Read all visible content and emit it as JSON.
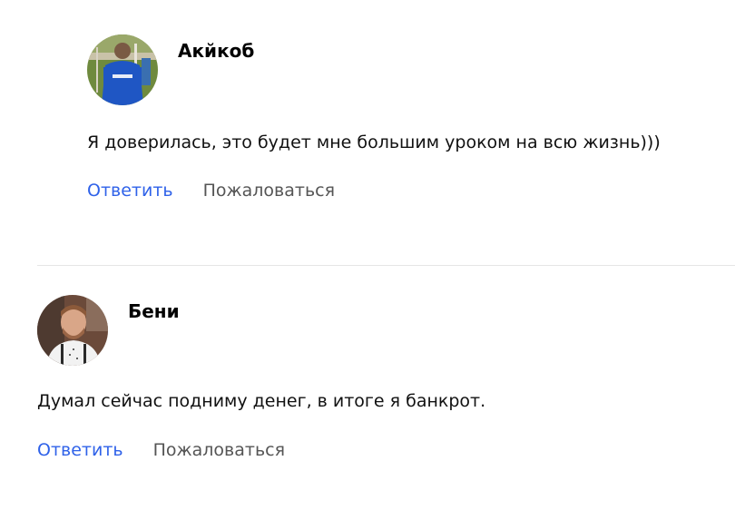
{
  "comments": [
    {
      "author": "Акйкоб",
      "text": "Я доверилась, это будет мне большим уроком на всю жизнь)))",
      "reply_label": "Ответить",
      "report_label": "Пожаловаться"
    },
    {
      "author": "Бени",
      "text": "Думал сейчас подниму денег, в итоге я банкрот.",
      "reply_label": "Ответить",
      "report_label": "Пожаловаться"
    }
  ],
  "colors": {
    "link_accent": "#2f62e9",
    "secondary_action": "#555555",
    "divider": "#e6e6e6"
  }
}
